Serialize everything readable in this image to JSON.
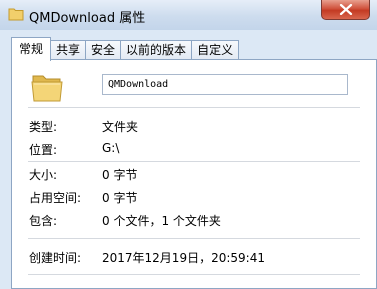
{
  "window": {
    "title": "QMDownload 属性",
    "close_icon": "close-icon",
    "close_color": "#c33a23"
  },
  "tabs": [
    {
      "label": "常规",
      "active": true
    },
    {
      "label": "共享",
      "active": false
    },
    {
      "label": "安全",
      "active": false
    },
    {
      "label": "以前的版本",
      "active": false
    },
    {
      "label": "自定义",
      "active": false
    }
  ],
  "general": {
    "folder_icon": "folder-icon",
    "name": "QMDownload",
    "rows": [
      {
        "label": "类型:",
        "value": "文件夹"
      },
      {
        "label": "位置:",
        "value": "G:\\"
      },
      {
        "label": "大小:",
        "value": "0 字节"
      },
      {
        "label": "占用空间:",
        "value": "0 字节"
      },
      {
        "label": "包含:",
        "value": "0 个文件，1 个文件夹"
      },
      {
        "label": "创建时间:",
        "value": "2017年12月19日，20:59:41"
      }
    ]
  }
}
